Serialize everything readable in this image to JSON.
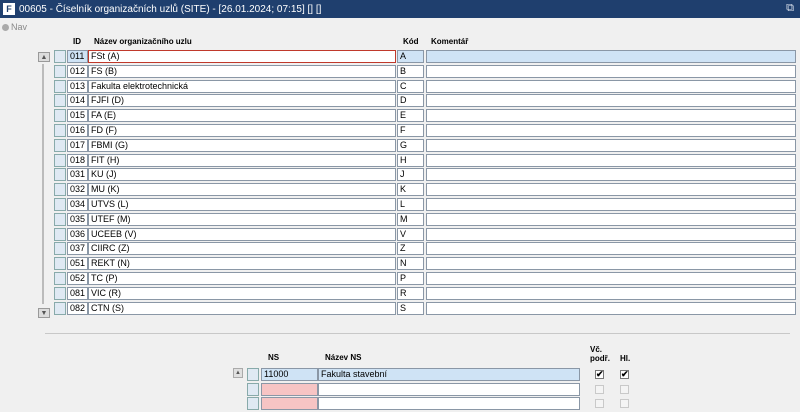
{
  "window": {
    "title": "00605 - Číselník organizačních uzlů (SITE) - [26.01.2024; 07:15] [] []",
    "app_icon": "F",
    "restore_icon": "⧉"
  },
  "nav": {
    "label": "Nav"
  },
  "grid": {
    "headers": {
      "id": "ID",
      "name": "Název organizačního uzlu",
      "code": "Kód",
      "comment": "Komentář"
    },
    "rows": [
      {
        "id": "011",
        "name": "FSt (A)",
        "code": "A",
        "comment": ""
      },
      {
        "id": "012",
        "name": "FS (B)",
        "code": "B",
        "comment": ""
      },
      {
        "id": "013",
        "name": "Fakulta elektrotechnická",
        "code": "C",
        "comment": ""
      },
      {
        "id": "014",
        "name": "FJFI (D)",
        "code": "D",
        "comment": ""
      },
      {
        "id": "015",
        "name": "FA (E)",
        "code": "E",
        "comment": ""
      },
      {
        "id": "016",
        "name": "FD (F)",
        "code": "F",
        "comment": ""
      },
      {
        "id": "017",
        "name": "FBMI (G)",
        "code": "G",
        "comment": ""
      },
      {
        "id": "018",
        "name": "FIT (H)",
        "code": "H",
        "comment": ""
      },
      {
        "id": "031",
        "name": "KU (J)",
        "code": "J",
        "comment": ""
      },
      {
        "id": "032",
        "name": "MU (K)",
        "code": "K",
        "comment": ""
      },
      {
        "id": "034",
        "name": "UTVS (L)",
        "code": "L",
        "comment": ""
      },
      {
        "id": "035",
        "name": "UTEF (M)",
        "code": "M",
        "comment": ""
      },
      {
        "id": "036",
        "name": "UCEEB (V)",
        "code": "V",
        "comment": ""
      },
      {
        "id": "037",
        "name": "CIIRC (Z)",
        "code": "Z",
        "comment": ""
      },
      {
        "id": "051",
        "name": "REKT (N)",
        "code": "N",
        "comment": ""
      },
      {
        "id": "052",
        "name": "TC (P)",
        "code": "P",
        "comment": ""
      },
      {
        "id": "081",
        "name": "VIC (R)",
        "code": "R",
        "comment": ""
      },
      {
        "id": "082",
        "name": "CTN (S)",
        "code": "S",
        "comment": ""
      }
    ]
  },
  "detail": {
    "headers": {
      "ns": "NS",
      "name": "Název NS",
      "vc_podr": "Vč. podř.",
      "hl": "Hl."
    },
    "rows": [
      {
        "ns": "11000",
        "name": "Fakulta stavební",
        "vc_podr": "✔",
        "hl": "✔"
      },
      {
        "ns": "",
        "name": "",
        "vc_podr": "",
        "hl": ""
      },
      {
        "ns": "",
        "name": "",
        "vc_podr": "",
        "hl": ""
      }
    ]
  }
}
